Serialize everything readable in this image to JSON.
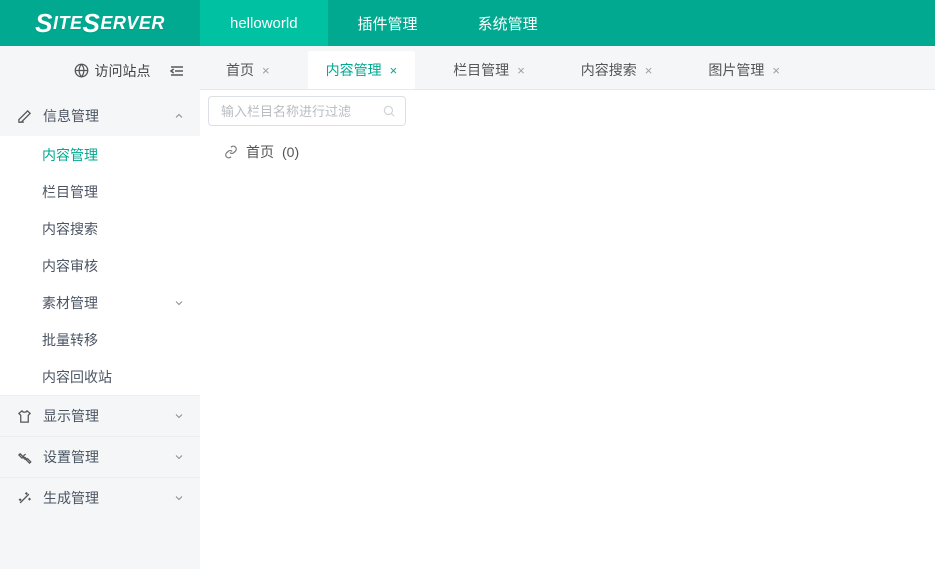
{
  "brand": {
    "name": "SiteServer"
  },
  "topnav": [
    {
      "label": "helloworld",
      "active": true
    },
    {
      "label": "插件管理",
      "active": false
    },
    {
      "label": "系统管理",
      "active": false
    }
  ],
  "visit": {
    "label": "访问站点"
  },
  "sidebar": {
    "groups": [
      {
        "icon": "edit",
        "label": "信息管理",
        "expanded": true,
        "children": [
          {
            "label": "内容管理",
            "active": true
          },
          {
            "label": "栏目管理"
          },
          {
            "label": "内容搜索"
          },
          {
            "label": "内容审核"
          }
        ],
        "submenus": [
          {
            "label": "素材管理"
          }
        ],
        "childrenAfter": [
          {
            "label": "批量转移"
          },
          {
            "label": "内容回收站"
          }
        ]
      },
      {
        "icon": "shirt",
        "label": "显示管理",
        "expanded": false
      },
      {
        "icon": "wrench",
        "label": "设置管理",
        "expanded": false
      },
      {
        "icon": "wand",
        "label": "生成管理",
        "expanded": false
      }
    ]
  },
  "tabs": [
    {
      "label": "首页",
      "active": false
    },
    {
      "label": "内容管理",
      "active": true
    },
    {
      "label": "栏目管理",
      "active": false
    },
    {
      "label": "内容搜索",
      "active": false
    },
    {
      "label": "图片管理",
      "active": false
    }
  ],
  "filter": {
    "placeholder": "输入栏目名称进行过滤"
  },
  "tree": {
    "root": {
      "label": "首页",
      "count": "(0)"
    }
  }
}
